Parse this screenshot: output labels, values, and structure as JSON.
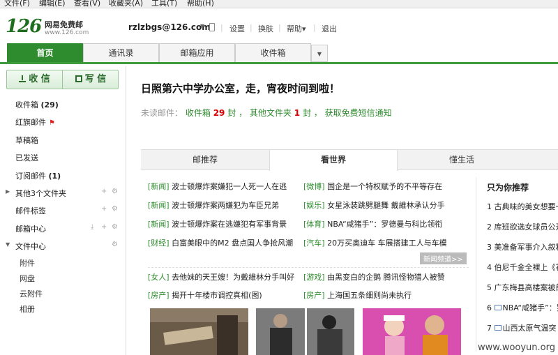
{
  "menubar": [
    "文件(F)",
    "编辑(E)",
    "查看(V)",
    "收藏夹(A)",
    "工具(T)",
    "帮助(H)"
  ],
  "header": {
    "logo_num": "126",
    "logo_cn": "网易免费邮",
    "logo_url": "www.126.com",
    "user_email": "rzlzbgs@126.com",
    "links": [
      "设置",
      "换肤",
      "帮助▾",
      "退出"
    ]
  },
  "tabs": [
    "首页",
    "通讯录",
    "邮箱应用",
    "收件箱"
  ],
  "sidebar": {
    "receive": "收 信",
    "write": "写 信",
    "folders": [
      {
        "label": "收件箱 ",
        "count": "(29)"
      },
      {
        "label": "红旗邮件",
        "count": ""
      },
      {
        "label": "草稿箱",
        "count": ""
      },
      {
        "label": "已发送",
        "count": ""
      },
      {
        "label": "订阅邮件 ",
        "count": "(1)"
      },
      {
        "label": "其他3个文件夹",
        "count": ""
      },
      {
        "label": "邮件标签",
        "count": ""
      },
      {
        "label": "邮箱中心",
        "count": ""
      },
      {
        "label": "文件中心",
        "count": ""
      }
    ],
    "sub": [
      "附件",
      "网盘",
      "云附件",
      "相册"
    ]
  },
  "main": {
    "headline": "日照第六中学办公室，走，宵夜时间到啦！",
    "unread_label": "未读邮件：",
    "inbox_label": "收件箱",
    "inbox_count": "29",
    "unit": "封",
    "other_label": "其他文件夹",
    "other_count": "1",
    "sms": "获取免费短信通知",
    "ptabs": [
      "邮推荐",
      "看世界",
      "懂生活"
    ],
    "news_left": [
      {
        "cat": "[新闻]",
        "text": "波士顿爆炸案嫌犯一人死一人在逃"
      },
      {
        "cat": "[新闻]",
        "text": "波士顿爆炸案两嫌犯为车臣兄弟"
      },
      {
        "cat": "[新闻]",
        "text": "波士顿爆炸案在逃嫌犯有军事背景"
      },
      {
        "cat": "[财经]",
        "text": "白富美眼中的M2 盘点国人争抢风潮"
      },
      {
        "cat": "[女人]",
        "text": "去他妹的天王嫂！为戴維林分手叫好"
      },
      {
        "cat": "[房产]",
        "text": "揭开十年楼市调控真相(图)"
      }
    ],
    "news_right": [
      {
        "cat": "[微博]",
        "text": "国企是一个特权赋予的不平等存在"
      },
      {
        "cat": "[娱乐]",
        "text": "女星泳装跳劈腿舞 戴維林承认分手"
      },
      {
        "cat": "[体育]",
        "text": "NBA“咸猪手”：罗德曼与科比领衔"
      },
      {
        "cat": "[汽车]",
        "text": "20万买奥迪车 车展搭建工人与车模"
      },
      {
        "cat": "[游戏]",
        "text": "由黑变白的企鹅 腾讯怪物猎人被赞"
      },
      {
        "cat": "[房产]",
        "text": "上海国五条细则尚未执行"
      }
    ],
    "more_news": "新闻频道>>",
    "rec_title": "只为你推荐",
    "recs": [
      {
        "n": "1",
        "text": "古典味的美女想要一"
      },
      {
        "n": "2",
        "text": "库班欲选女球员公开"
      },
      {
        "n": "3",
        "text": "美准备军事介入叙利"
      },
      {
        "n": "4",
        "text": "伯尼千金全裸上《花"
      },
      {
        "n": "5",
        "text": "广东梅县高楼案被前"
      },
      {
        "n": "6",
        "text": "NBA“咸猪手”：罗"
      },
      {
        "n": "7",
        "text": "山西太原气温突"
      }
    ]
  },
  "watermark": "www.wooyun.org",
  "colors": {
    "brand_green": "#2e8b2e",
    "alert_red": "#dd0000"
  }
}
